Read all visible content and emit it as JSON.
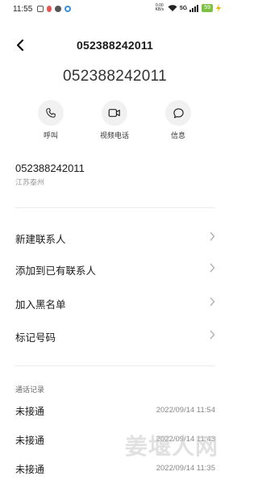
{
  "status_bar": {
    "time": "11:55",
    "speed": "0.00\nKB/s",
    "network": "5G",
    "battery": "59"
  },
  "header": {
    "title": "052388242011"
  },
  "contact": {
    "number_large": "052388242011",
    "number": "052388242011",
    "location": "江苏泰州"
  },
  "actions": [
    {
      "label": "呼叫",
      "icon": "phone-icon"
    },
    {
      "label": "视频电话",
      "icon": "video-icon"
    },
    {
      "label": "信息",
      "icon": "message-icon"
    }
  ],
  "menu": [
    {
      "label": "新建联系人"
    },
    {
      "label": "添加到已有联系人"
    },
    {
      "label": "加入黑名单"
    },
    {
      "label": "标记号码"
    }
  ],
  "call_log": {
    "title": "通话记录",
    "items": [
      {
        "status": "未接通",
        "time": "2022/09/14 11:54"
      },
      {
        "status": "未接通",
        "time": "2022/09/14 11:43"
      },
      {
        "status": "未接通",
        "time": "2022/09/14 11:35"
      }
    ]
  },
  "watermark": "姜堰人网",
  "colors": {
    "accent_battery": "#7bc043",
    "text_primary": "#1a1a1a",
    "text_secondary": "#999999"
  }
}
